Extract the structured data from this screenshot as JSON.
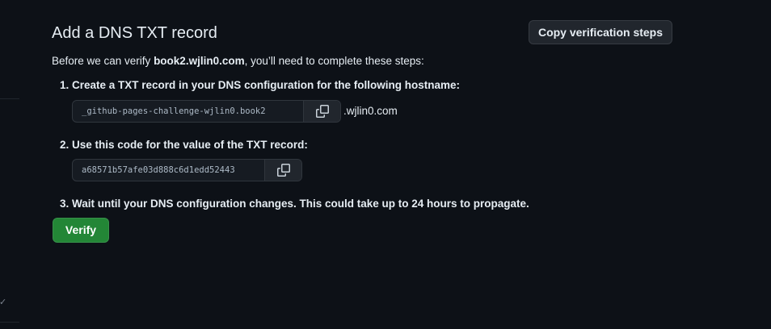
{
  "header": {
    "title": "Add a DNS TXT record",
    "copy_steps_label": "Copy verification steps"
  },
  "intro": {
    "prefix": "Before we can verify ",
    "domain": "book2.wjlin0.com",
    "suffix": ", you’ll need to complete these steps:"
  },
  "steps": [
    {
      "text": "1. Create a TXT record in your DNS configuration for the following hostname:",
      "value": "_github-pages-challenge-wjlin0.book2",
      "value_suffix": ".wjlin0.com"
    },
    {
      "text": "2. Use this code for the value of the TXT record:",
      "value": "a68571b57afe03d888c6d1edd52443"
    },
    {
      "text": "3. Wait until your DNS configuration changes. This could take up to 24 hours to propagate."
    }
  ],
  "actions": {
    "verify_label": "Verify"
  },
  "icons": {
    "copy": "copy-icon",
    "sidebar_chevron": "chevron-down-icon"
  },
  "colors": {
    "background": "#0d1117",
    "primary_button": "#238636",
    "text": "#e6edf3"
  }
}
